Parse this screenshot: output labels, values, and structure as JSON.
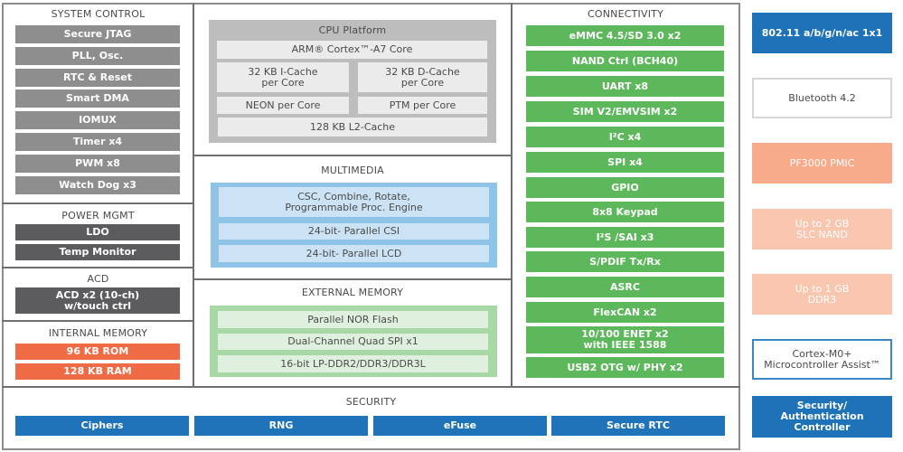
{
  "system_control": {
    "title": "SYSTEM CONTROL",
    "items": [
      "Secure JTAG",
      "PLL, Osc.",
      "RTC & Reset",
      "Smart DMA",
      "IOMUX",
      "Timer x4",
      "PWM x8",
      "Watch Dog x3"
    ]
  },
  "power_mgmt": {
    "title": "POWER MGMT",
    "items": [
      "LDO",
      "Temp Monitor"
    ]
  },
  "acd": {
    "title": "ACD",
    "items": [
      "ACD x2 (10-ch)\nw/touch ctrl"
    ]
  },
  "internal_memory": {
    "title": "INTERNAL MEMORY",
    "items": [
      "96 KB ROM",
      "128 KB RAM"
    ]
  },
  "cpu_platform": {
    "title": "CPU Platform",
    "core": "ARM® Cortex™-A7 Core",
    "icache": "32 KB I-Cache\nper Core",
    "dcache": "32 KB D-Cache\nper Core",
    "neon": "NEON per Core",
    "ptm": "PTM per Core",
    "l2": "128 KB L2-Cache"
  },
  "multimedia": {
    "title": "MULTIMEDIA",
    "items": [
      "CSC, Combine, Rotate,\nProgrammable Proc. Engine",
      "24-bit- Parallel CSI",
      "24-bit- Parallel LCD"
    ]
  },
  "external_memory": {
    "title": "EXTERNAL MEMORY",
    "items": [
      "Parallel NOR Flash",
      "Dual-Channel Quad SPI  x1",
      "16-bit LP-DDR2/DDR3/DDR3L"
    ]
  },
  "connectivity": {
    "title": "CONNECTIVITY",
    "items": [
      "eMMC 4.5/SD 3.0 x2",
      "NAND Ctrl (BCH40)",
      "UART x8",
      "SIM V2/EMVSIM x2",
      "I²C x4",
      "SPI x4",
      "GPIO",
      "8x8 Keypad",
      "I²S /SAI x3",
      "S/PDIF Tx/Rx",
      "ASRC",
      "FlexCAN x2",
      "10/100 ENET x2\nwith IEEE 1588",
      "USB2 OTG w/ PHY x2"
    ]
  },
  "security": {
    "title": "SECURITY",
    "items": [
      "Ciphers",
      "RNG",
      "eFuse",
      "Secure RTC"
    ]
  },
  "external_components": [
    "802.11 a/b/g/n/ac 1x1",
    "Bluetooth 4.2",
    "PF3000 PMIC",
    "Up to 2 GB\nSLC NAND",
    "Up to 1 GB\nDDR3",
    "Cortex-M0+\nMicrocontroller Assist™",
    "Security/\nAuthentication\nController"
  ],
  "colors": {
    "system_control": "#8e8e8e",
    "power_acd": "#5c5c5f",
    "internal_memory": "#ef6b45",
    "connectivity": "#5cb85a",
    "security": "#1f73b9",
    "cpu_platform": "#bdbdbd",
    "multimedia": "#8fc4e8",
    "external_memory": "#a8d8a5"
  }
}
